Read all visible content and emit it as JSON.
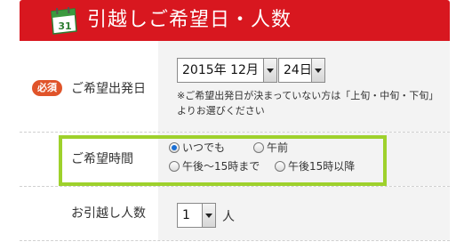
{
  "header": {
    "title": "引越しご希望日・人数",
    "icon_label": "31"
  },
  "moving_date": {
    "required_badge": "必須",
    "label": "ご希望出発日",
    "year_month": "2015年 12月",
    "day": "24日",
    "note": "※ご希望出発日が決まっていない方は「上旬・中旬・下旬」よりお選びください"
  },
  "moving_time": {
    "label": "ご希望時間",
    "options": [
      {
        "label": "いつでも",
        "checked": true
      },
      {
        "label": "午前",
        "checked": false
      },
      {
        "label": "午後～15時まで",
        "checked": false
      },
      {
        "label": "午後15時以降",
        "checked": false
      }
    ]
  },
  "movers": {
    "label": "お引越し人数",
    "count": "1",
    "unit": "人"
  },
  "colors": {
    "header": "#d8171f",
    "highlight": "#9ed12c",
    "badge": "#e0542a",
    "value_bg": "#f3f3f3"
  }
}
